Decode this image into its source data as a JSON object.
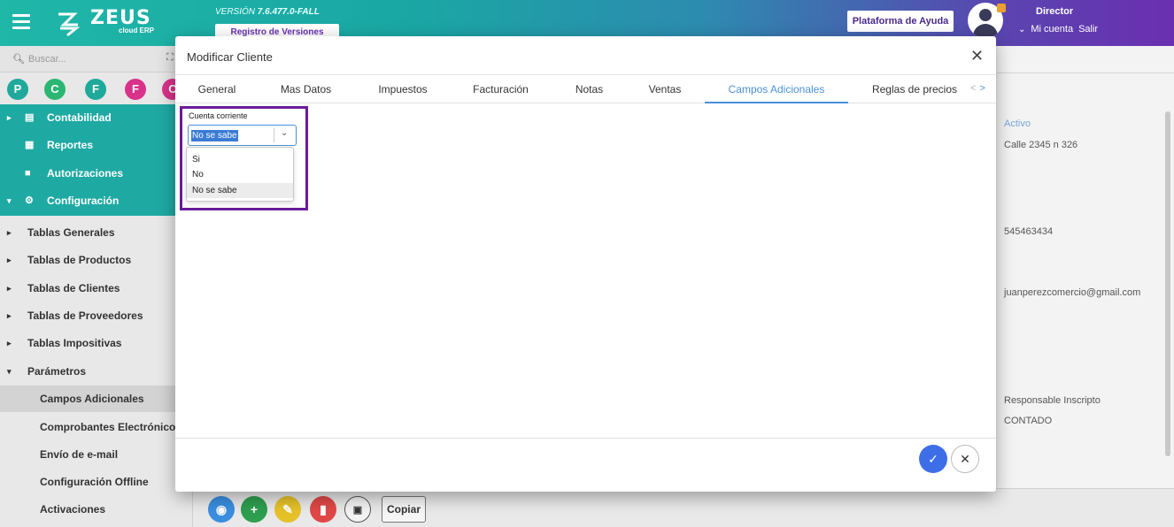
{
  "header": {
    "logo_text": "ZEUS",
    "logo_sub": "cloud ERP",
    "version_prefix": "VERSIÓN ",
    "version_value": "7.6.477.0-FALL",
    "versions_button": "Registro de Versiones",
    "help_button": "Plataforma de Ayuda",
    "role": "Director",
    "account_label": "Mi cuenta",
    "logout_label": "Salir"
  },
  "sidebar": {
    "search_placeholder": "Buscar...",
    "letters": [
      {
        "letter": "P",
        "color": "#1fa99b"
      },
      {
        "letter": "C",
        "color": "#2bb673"
      },
      {
        "letter": "F",
        "color": "#1fa99b"
      },
      {
        "letter": "F",
        "color": "#d9328a"
      },
      {
        "letter": "C",
        "color": "#d9328a"
      }
    ],
    "teal_items": [
      {
        "label": "Contabilidad",
        "icon": "book-icon"
      },
      {
        "label": "Reportes",
        "icon": "report-icon"
      },
      {
        "label": "Autorizaciones",
        "icon": "lock-icon"
      },
      {
        "label": "Configuración",
        "icon": "gears-icon"
      }
    ],
    "items": [
      {
        "label": "Tablas Generales"
      },
      {
        "label": "Tablas de Productos"
      },
      {
        "label": "Tablas de Clientes"
      },
      {
        "label": "Tablas de Proveedores"
      },
      {
        "label": "Tablas Impositivas"
      },
      {
        "label": "Parámetros"
      }
    ],
    "sub_items": [
      {
        "label": "Campos Adicionales"
      },
      {
        "label": "Comprobantes Electrónicos"
      },
      {
        "label": "Envío de e-mail"
      },
      {
        "label": "Configuración Offline"
      },
      {
        "label": "Activaciones"
      }
    ]
  },
  "background": {
    "status": "Activo",
    "address": "Calle 2345 n 326",
    "phone": "545463434",
    "email": "juanperezcomercio@gmail.com",
    "tax_condition": "Responsable Inscripto",
    "payment": "CONTADO"
  },
  "toolbar": {
    "copy_label": "Copiar"
  },
  "modal": {
    "title": "Modificar Cliente",
    "tabs": [
      {
        "label": "General"
      },
      {
        "label": "Mas Datos"
      },
      {
        "label": "Impuestos"
      },
      {
        "label": "Facturación"
      },
      {
        "label": "Notas"
      },
      {
        "label": "Ventas"
      },
      {
        "label": "Campos Adicionales"
      },
      {
        "label": "Reglas de precios"
      }
    ],
    "active_tab": "Campos Adicionales",
    "field": {
      "label": "Cuenta corriente",
      "value": "No se sabe",
      "options": [
        "Si",
        "No",
        "No se sabe"
      ]
    }
  },
  "colors": {
    "accent": "#4a90d9",
    "highlight_box": "#6a1b9a",
    "ok_button": "#3d6ee8"
  }
}
